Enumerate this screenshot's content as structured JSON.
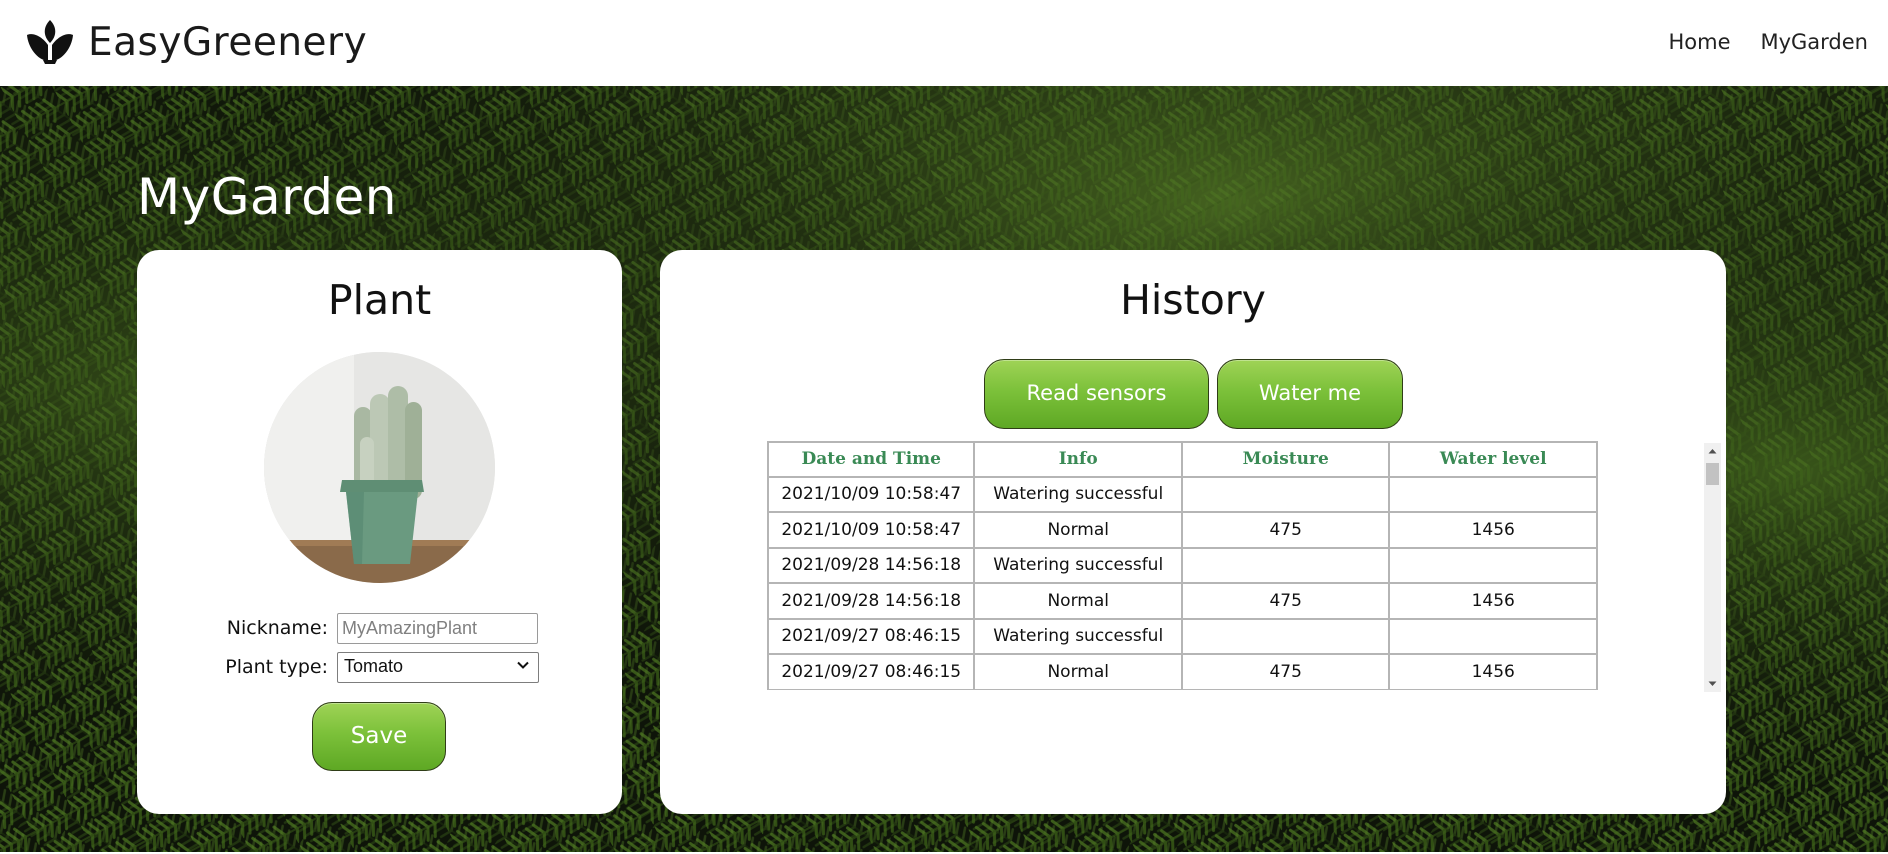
{
  "header": {
    "brand": "EasyGreenery",
    "nav": [
      {
        "label": "Home"
      },
      {
        "label": "MyGarden"
      }
    ]
  },
  "page": {
    "title": "MyGarden"
  },
  "plant_card": {
    "title": "Plant",
    "nickname_label": "Nickname:",
    "nickname_placeholder": "MyAmazingPlant",
    "plant_type_label": "Plant type:",
    "plant_type_selected": "Tomato",
    "save_label": "Save",
    "photo_icon": "potted-cactus"
  },
  "history_card": {
    "title": "History",
    "read_sensors_label": "Read sensors",
    "water_me_label": "Water me",
    "columns": [
      "Date and Time",
      "Info",
      "Moisture",
      "Water level"
    ],
    "rows": [
      [
        "2021/10/09 10:58:47",
        "Watering successful",
        "",
        ""
      ],
      [
        "2021/10/09 10:58:47",
        "Normal",
        "475",
        "1456"
      ],
      [
        "2021/09/28 14:56:18",
        "Watering successful",
        "",
        ""
      ],
      [
        "2021/09/28 14:56:18",
        "Normal",
        "475",
        "1456"
      ],
      [
        "2021/09/27 08:46:15",
        "Watering successful",
        "",
        ""
      ],
      [
        "2021/09/27 08:46:15",
        "Normal",
        "475",
        "1456"
      ]
    ]
  },
  "colors": {
    "button_green": "#7cc13a",
    "header_text_green": "#3a8a55",
    "background_dark": "#0e1409"
  }
}
